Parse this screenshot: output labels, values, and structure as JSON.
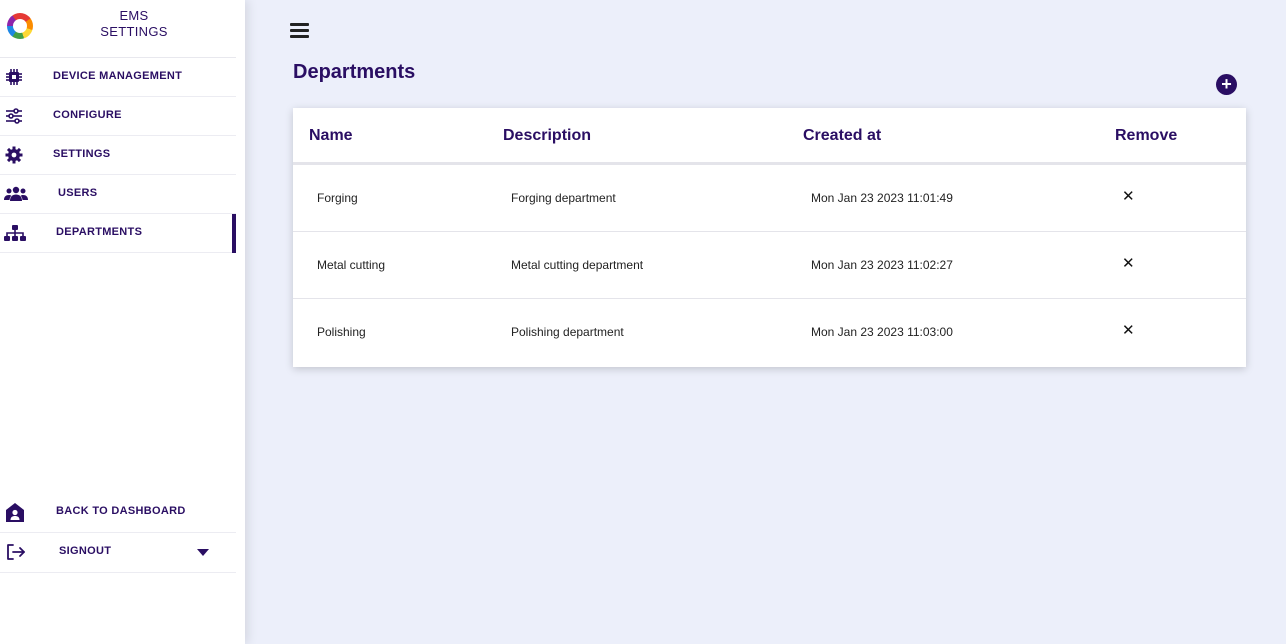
{
  "brand": {
    "line1": "EMS",
    "line2": "SETTINGS"
  },
  "sidebar": {
    "items": [
      {
        "label": "DEVICE MANAGEMENT",
        "icon": "chip-icon"
      },
      {
        "label": "CONFIGURE",
        "icon": "sliders-icon"
      },
      {
        "label": "SETTINGS",
        "icon": "gear-icon"
      },
      {
        "label": "USERS",
        "icon": "users-icon"
      },
      {
        "label": "DEPARTMENTS",
        "icon": "hierarchy-icon",
        "active": true
      }
    ],
    "bottom": [
      {
        "label": "BACK TO DASHBOARD",
        "icon": "home-user-icon"
      },
      {
        "label": "SIGNOUT",
        "icon": "signout-icon"
      }
    ]
  },
  "main": {
    "title": "Departments",
    "add_icon": "+",
    "columns": [
      "Name",
      "Description",
      "Created at",
      "Remove"
    ],
    "rows": [
      {
        "name": "Forging",
        "description": "Forging department",
        "created_at": "Mon Jan 23 2023 11:01:49",
        "remove": "✕"
      },
      {
        "name": "Metal cutting",
        "description": "Metal cutting department",
        "created_at": "Mon Jan 23 2023 11:02:27",
        "remove": "✕"
      },
      {
        "name": "Polishing",
        "description": "Polishing department",
        "created_at": "Mon Jan 23 2023 11:03:00",
        "remove": "✕"
      }
    ]
  },
  "colors": {
    "accent": "#2a0e63",
    "background": "#eceffa"
  }
}
